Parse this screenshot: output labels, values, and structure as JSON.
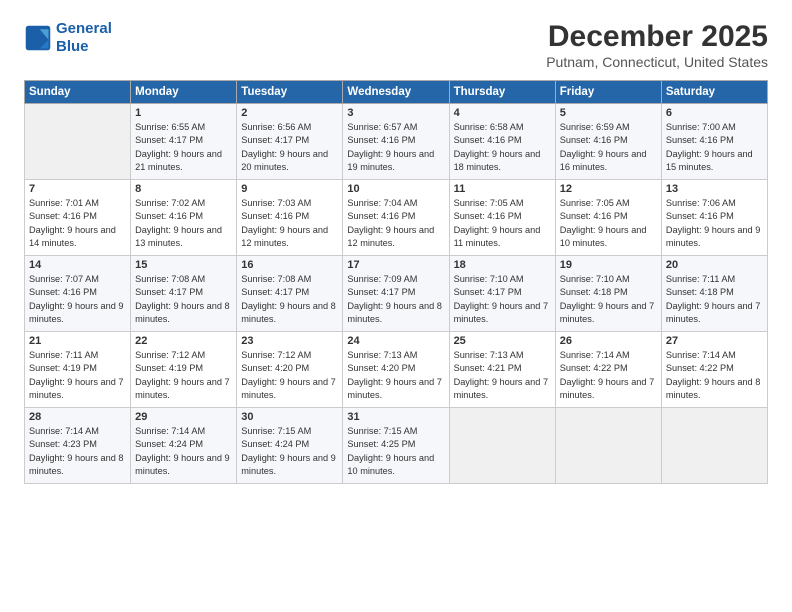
{
  "logo": {
    "line1": "General",
    "line2": "Blue"
  },
  "title": "December 2025",
  "subtitle": "Putnam, Connecticut, United States",
  "header_days": [
    "Sunday",
    "Monday",
    "Tuesday",
    "Wednesday",
    "Thursday",
    "Friday",
    "Saturday"
  ],
  "weeks": [
    [
      {
        "num": "",
        "sunrise": "",
        "sunset": "",
        "daylight": ""
      },
      {
        "num": "1",
        "sunrise": "Sunrise: 6:55 AM",
        "sunset": "Sunset: 4:17 PM",
        "daylight": "Daylight: 9 hours and 21 minutes."
      },
      {
        "num": "2",
        "sunrise": "Sunrise: 6:56 AM",
        "sunset": "Sunset: 4:17 PM",
        "daylight": "Daylight: 9 hours and 20 minutes."
      },
      {
        "num": "3",
        "sunrise": "Sunrise: 6:57 AM",
        "sunset": "Sunset: 4:16 PM",
        "daylight": "Daylight: 9 hours and 19 minutes."
      },
      {
        "num": "4",
        "sunrise": "Sunrise: 6:58 AM",
        "sunset": "Sunset: 4:16 PM",
        "daylight": "Daylight: 9 hours and 18 minutes."
      },
      {
        "num": "5",
        "sunrise": "Sunrise: 6:59 AM",
        "sunset": "Sunset: 4:16 PM",
        "daylight": "Daylight: 9 hours and 16 minutes."
      },
      {
        "num": "6",
        "sunrise": "Sunrise: 7:00 AM",
        "sunset": "Sunset: 4:16 PM",
        "daylight": "Daylight: 9 hours and 15 minutes."
      }
    ],
    [
      {
        "num": "7",
        "sunrise": "Sunrise: 7:01 AM",
        "sunset": "Sunset: 4:16 PM",
        "daylight": "Daylight: 9 hours and 14 minutes."
      },
      {
        "num": "8",
        "sunrise": "Sunrise: 7:02 AM",
        "sunset": "Sunset: 4:16 PM",
        "daylight": "Daylight: 9 hours and 13 minutes."
      },
      {
        "num": "9",
        "sunrise": "Sunrise: 7:03 AM",
        "sunset": "Sunset: 4:16 PM",
        "daylight": "Daylight: 9 hours and 12 minutes."
      },
      {
        "num": "10",
        "sunrise": "Sunrise: 7:04 AM",
        "sunset": "Sunset: 4:16 PM",
        "daylight": "Daylight: 9 hours and 12 minutes."
      },
      {
        "num": "11",
        "sunrise": "Sunrise: 7:05 AM",
        "sunset": "Sunset: 4:16 PM",
        "daylight": "Daylight: 9 hours and 11 minutes."
      },
      {
        "num": "12",
        "sunrise": "Sunrise: 7:05 AM",
        "sunset": "Sunset: 4:16 PM",
        "daylight": "Daylight: 9 hours and 10 minutes."
      },
      {
        "num": "13",
        "sunrise": "Sunrise: 7:06 AM",
        "sunset": "Sunset: 4:16 PM",
        "daylight": "Daylight: 9 hours and 9 minutes."
      }
    ],
    [
      {
        "num": "14",
        "sunrise": "Sunrise: 7:07 AM",
        "sunset": "Sunset: 4:16 PM",
        "daylight": "Daylight: 9 hours and 9 minutes."
      },
      {
        "num": "15",
        "sunrise": "Sunrise: 7:08 AM",
        "sunset": "Sunset: 4:17 PM",
        "daylight": "Daylight: 9 hours and 8 minutes."
      },
      {
        "num": "16",
        "sunrise": "Sunrise: 7:08 AM",
        "sunset": "Sunset: 4:17 PM",
        "daylight": "Daylight: 9 hours and 8 minutes."
      },
      {
        "num": "17",
        "sunrise": "Sunrise: 7:09 AM",
        "sunset": "Sunset: 4:17 PM",
        "daylight": "Daylight: 9 hours and 8 minutes."
      },
      {
        "num": "18",
        "sunrise": "Sunrise: 7:10 AM",
        "sunset": "Sunset: 4:17 PM",
        "daylight": "Daylight: 9 hours and 7 minutes."
      },
      {
        "num": "19",
        "sunrise": "Sunrise: 7:10 AM",
        "sunset": "Sunset: 4:18 PM",
        "daylight": "Daylight: 9 hours and 7 minutes."
      },
      {
        "num": "20",
        "sunrise": "Sunrise: 7:11 AM",
        "sunset": "Sunset: 4:18 PM",
        "daylight": "Daylight: 9 hours and 7 minutes."
      }
    ],
    [
      {
        "num": "21",
        "sunrise": "Sunrise: 7:11 AM",
        "sunset": "Sunset: 4:19 PM",
        "daylight": "Daylight: 9 hours and 7 minutes."
      },
      {
        "num": "22",
        "sunrise": "Sunrise: 7:12 AM",
        "sunset": "Sunset: 4:19 PM",
        "daylight": "Daylight: 9 hours and 7 minutes."
      },
      {
        "num": "23",
        "sunrise": "Sunrise: 7:12 AM",
        "sunset": "Sunset: 4:20 PM",
        "daylight": "Daylight: 9 hours and 7 minutes."
      },
      {
        "num": "24",
        "sunrise": "Sunrise: 7:13 AM",
        "sunset": "Sunset: 4:20 PM",
        "daylight": "Daylight: 9 hours and 7 minutes."
      },
      {
        "num": "25",
        "sunrise": "Sunrise: 7:13 AM",
        "sunset": "Sunset: 4:21 PM",
        "daylight": "Daylight: 9 hours and 7 minutes."
      },
      {
        "num": "26",
        "sunrise": "Sunrise: 7:14 AM",
        "sunset": "Sunset: 4:22 PM",
        "daylight": "Daylight: 9 hours and 7 minutes."
      },
      {
        "num": "27",
        "sunrise": "Sunrise: 7:14 AM",
        "sunset": "Sunset: 4:22 PM",
        "daylight": "Daylight: 9 hours and 8 minutes."
      }
    ],
    [
      {
        "num": "28",
        "sunrise": "Sunrise: 7:14 AM",
        "sunset": "Sunset: 4:23 PM",
        "daylight": "Daylight: 9 hours and 8 minutes."
      },
      {
        "num": "29",
        "sunrise": "Sunrise: 7:14 AM",
        "sunset": "Sunset: 4:24 PM",
        "daylight": "Daylight: 9 hours and 9 minutes."
      },
      {
        "num": "30",
        "sunrise": "Sunrise: 7:15 AM",
        "sunset": "Sunset: 4:24 PM",
        "daylight": "Daylight: 9 hours and 9 minutes."
      },
      {
        "num": "31",
        "sunrise": "Sunrise: 7:15 AM",
        "sunset": "Sunset: 4:25 PM",
        "daylight": "Daylight: 9 hours and 10 minutes."
      },
      {
        "num": "",
        "sunrise": "",
        "sunset": "",
        "daylight": ""
      },
      {
        "num": "",
        "sunrise": "",
        "sunset": "",
        "daylight": ""
      },
      {
        "num": "",
        "sunrise": "",
        "sunset": "",
        "daylight": ""
      }
    ]
  ]
}
